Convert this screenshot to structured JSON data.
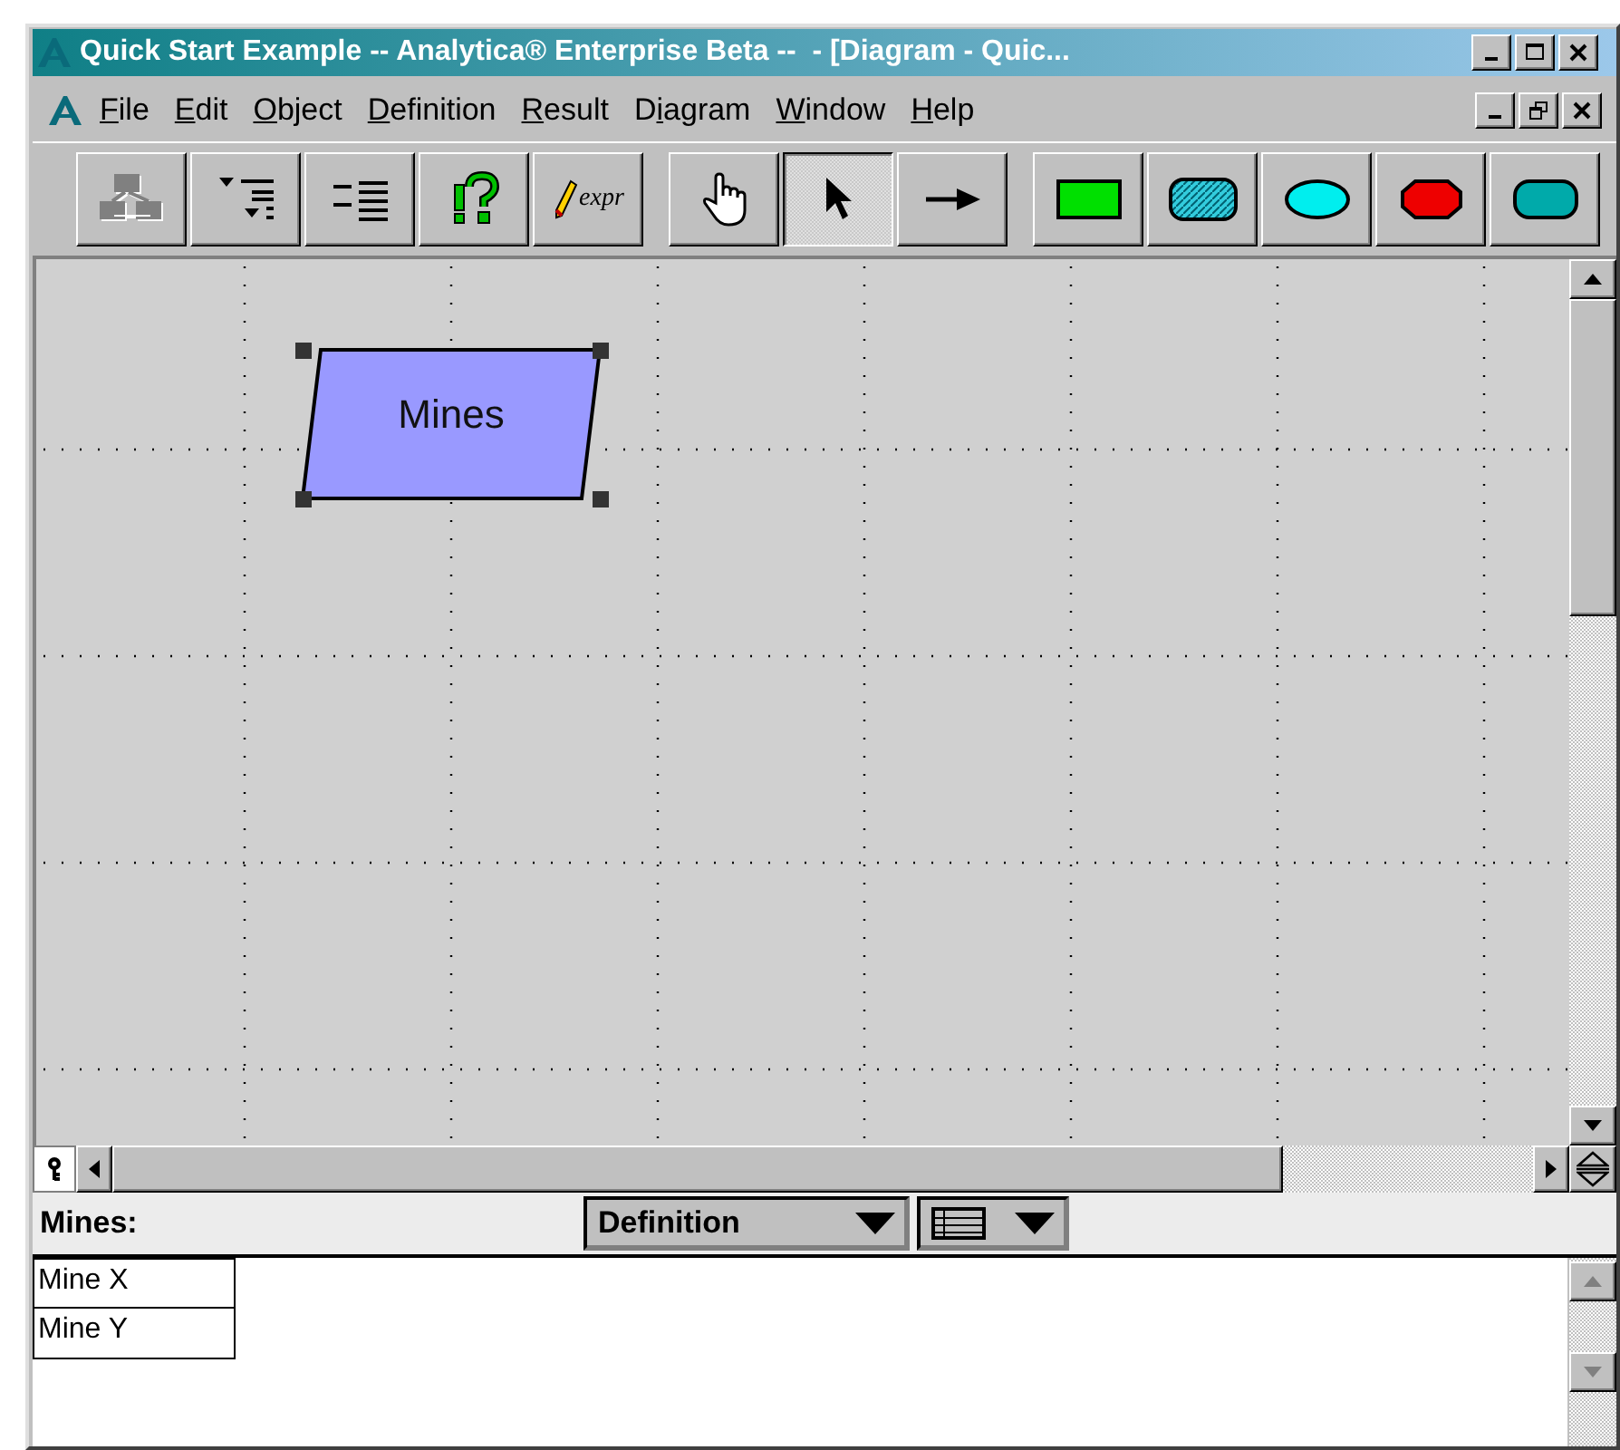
{
  "window": {
    "title": "Quick Start Example -- Analytica® Enterprise Beta --  - [Diagram - Quic..."
  },
  "menu": {
    "items": [
      {
        "key": "F",
        "after": "ile"
      },
      {
        "key": "E",
        "after": "dit"
      },
      {
        "key": "O",
        "after": "bject"
      },
      {
        "key": "D",
        "after": "efinition"
      },
      {
        "key": "R",
        "after": "esult"
      },
      {
        "before": "D",
        "key": "i",
        "after": "agram"
      },
      {
        "key": "W",
        "after": "indow"
      },
      {
        "key": "H",
        "after": "elp"
      }
    ]
  },
  "toolbar": {
    "groups": [
      [
        {
          "kind": "diagram",
          "disabled": true,
          "selected": false
        },
        {
          "kind": "outline-down",
          "disabled": false,
          "selected": false
        },
        {
          "kind": "outline",
          "disabled": false,
          "selected": false
        },
        {
          "kind": "help",
          "selected": false
        },
        {
          "kind": "expr",
          "label": "expr",
          "selected": false
        }
      ],
      [
        {
          "kind": "hand",
          "selected": false
        },
        {
          "kind": "pointer",
          "selected": true
        },
        {
          "kind": "arrow",
          "selected": false
        }
      ],
      [
        {
          "kind": "rect",
          "color": "#00e000",
          "selected": false
        },
        {
          "kind": "hatched",
          "color": "#33ccdd",
          "selected": false
        },
        {
          "kind": "oval",
          "color": "#00eeee",
          "selected": false
        },
        {
          "kind": "octagon",
          "color": "#ee0000",
          "selected": false
        },
        {
          "kind": "rounded",
          "color": "#00aaaa",
          "selected": false
        }
      ]
    ]
  },
  "diagram": {
    "nodes": [
      {
        "kind": "index",
        "label": "Mines",
        "selected": true
      }
    ]
  },
  "attribute_panel": {
    "object": "Mines:",
    "attribute": "Definition",
    "values": [
      "Mine X",
      "Mine Y"
    ]
  }
}
